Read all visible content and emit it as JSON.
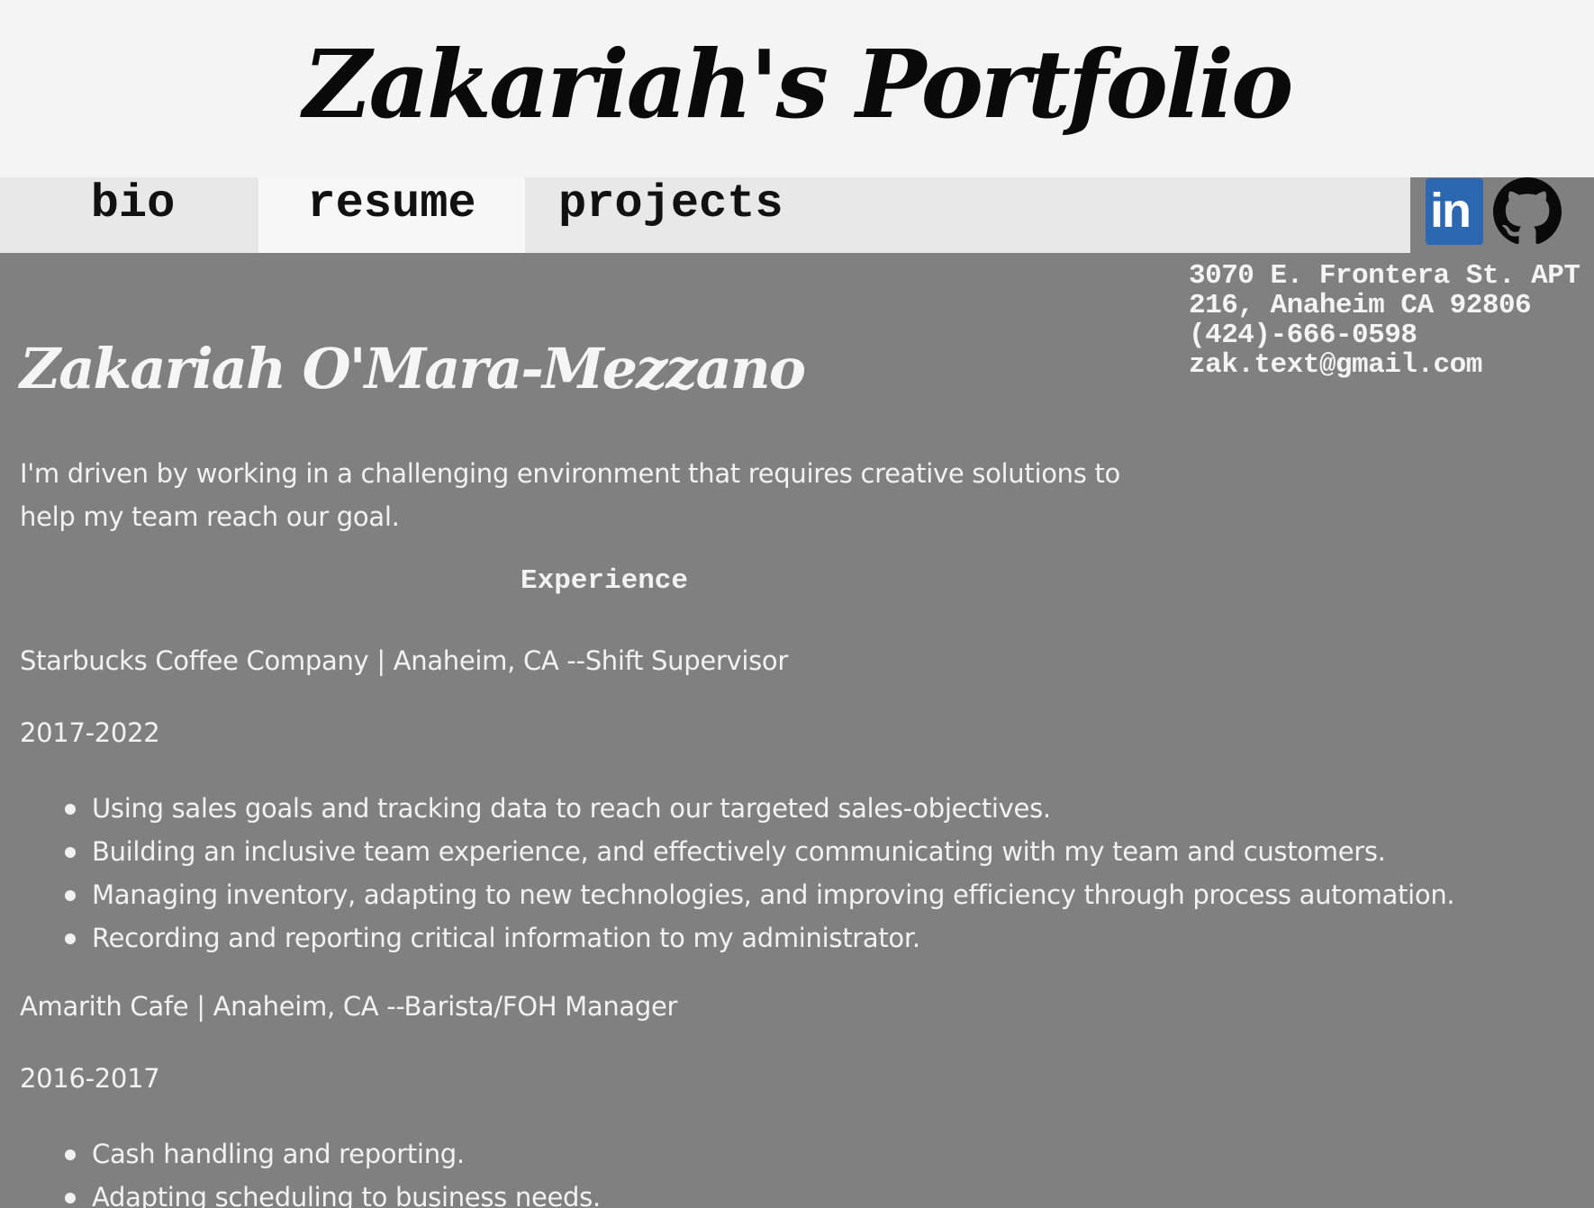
{
  "header": {
    "title": "Zakariah's Portfolio"
  },
  "nav": {
    "tabs": [
      {
        "label": "bio"
      },
      {
        "label": "resume"
      },
      {
        "label": "projects"
      }
    ],
    "active_tab": "resume"
  },
  "social": {
    "linkedin_icon": "linkedin-icon",
    "linkedin_text": "in",
    "github_icon": "github-icon"
  },
  "contact": {
    "address_line1": "3070 E. Frontera St. APT",
    "address_line2": "216, Anaheim CA 92806",
    "phone": "(424)-666-0598",
    "email": "zak.text@gmail.com"
  },
  "resume": {
    "name": "Zakariah O'Mara-Mezzano",
    "summary": "I'm driven by working in a challenging environment that requires creative solutions to help my team reach our goal.",
    "experience_heading": "Experience",
    "jobs": [
      {
        "title": "Starbucks Coffee Company | Anaheim, CA --Shift Supervisor",
        "dates": "2017-2022",
        "bullets": [
          "Using sales goals and tracking data to reach our targeted sales-objectives.",
          "Building an inclusive team experience, and effectively communicating with my team and customers.",
          "Managing inventory, adapting to new technologies, and improving efficiency through process automation.",
          "Recording and reporting critical information to my administrator."
        ]
      },
      {
        "title": "Amarith Cafe | Anaheim, CA --Barista/FOH Manager",
        "dates": "2016-2017",
        "bullets": [
          "Cash handling and reporting.",
          "Adapting scheduling to business needs."
        ]
      }
    ]
  },
  "colors": {
    "header_bg": "#f4f4f4",
    "nav_bg": "#e8e8e8",
    "active_tab_bg": "#f7f7f7",
    "page_bg": "#808080",
    "linkedin_blue": "#2c67b1"
  }
}
